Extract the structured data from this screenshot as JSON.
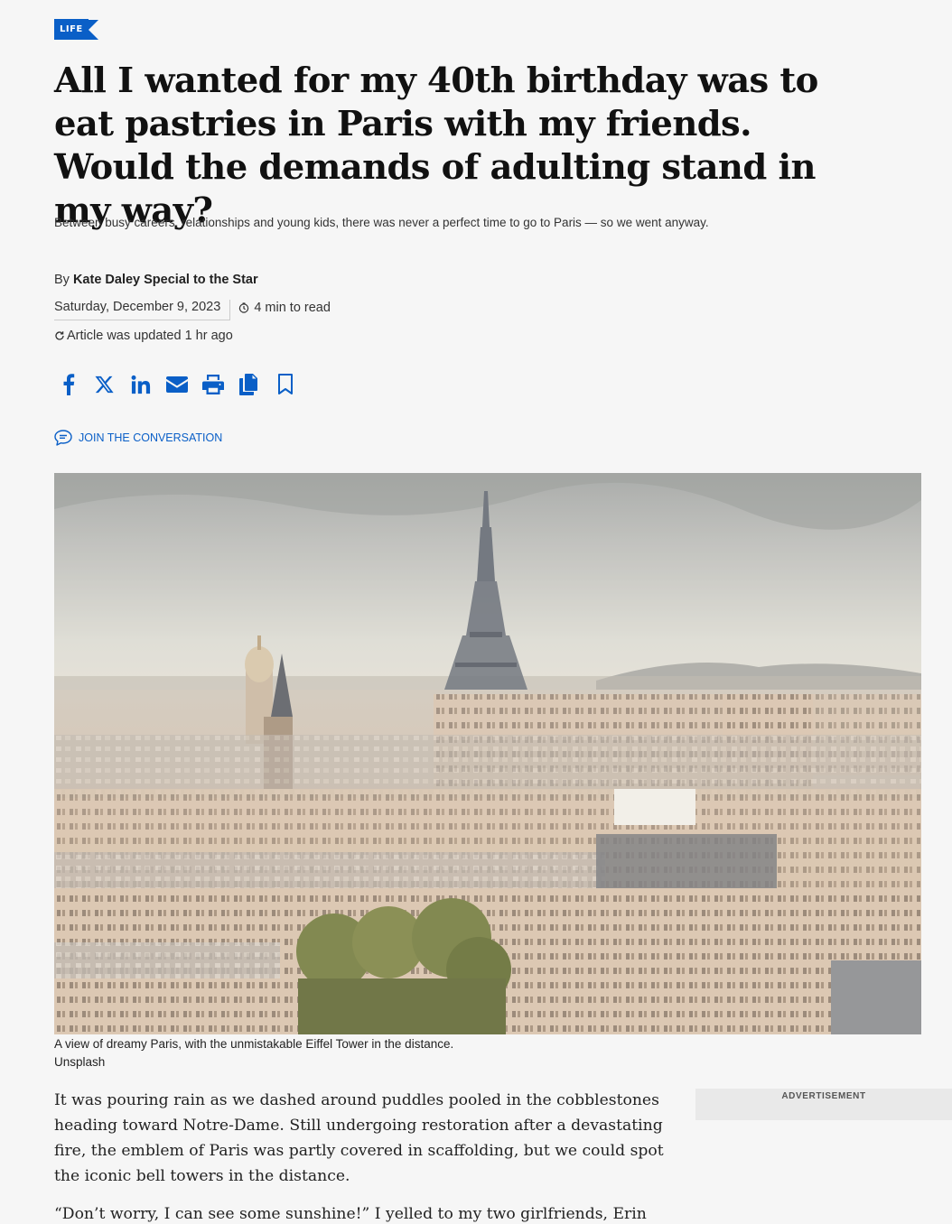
{
  "section": {
    "label": "LIFE"
  },
  "article": {
    "headline": "All I wanted for my 40th birthday was to eat pastries in Paris with my friends. Would the demands of adulting stand in my way?",
    "subhead": "Between busy careers, relationships and young kids, there was never a perfect time to go to Paris — so we went anyway.",
    "byline_prefix": "By",
    "author": "Kate Daley Special to the Star",
    "date": "Saturday, December 9, 2023",
    "read_time": "4 min to read",
    "updated": "Article was updated 1 hr ago"
  },
  "share": {
    "icons": [
      "facebook-icon",
      "x-icon",
      "linkedin-icon",
      "email-icon",
      "print-icon",
      "copy-icon",
      "bookmark-icon"
    ]
  },
  "conversation": {
    "label": "JOIN THE CONVERSATION"
  },
  "hero": {
    "caption": "A view of dreamy Paris, with the unmistakable Eiffel Tower in the distance.",
    "credit": "Unsplash"
  },
  "body": {
    "paragraphs": [
      "It was pouring rain as we dashed around puddles pooled in the cobblestones heading toward Notre-Dame. Still undergoing restoration after a devastating fire, the emblem of Paris was partly covered in scaffolding, but we could spot the iconic bell towers in the distance.",
      "“Don’t worry, I can see some sunshine!” I yelled to my two girlfriends, Erin and"
    ]
  },
  "ad": {
    "label": "ADVERTISEMENT"
  },
  "colors": {
    "accent": "#0a5fc7",
    "background": "#f6f6f6"
  }
}
